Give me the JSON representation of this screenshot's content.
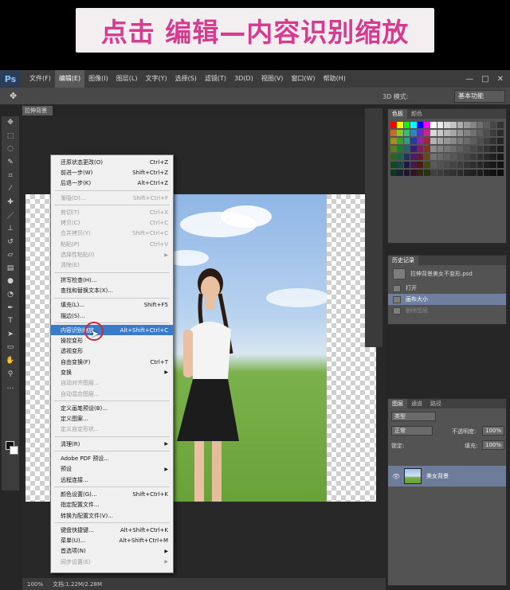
{
  "banner": {
    "title": "点击 编辑—内容识别缩放"
  },
  "menubar": {
    "logo": "Ps",
    "items": [
      "文件(F)",
      "编辑(E)",
      "图像(I)",
      "图层(L)",
      "文字(Y)",
      "选择(S)",
      "滤镜(T)",
      "3D(D)",
      "视图(V)",
      "窗口(W)",
      "帮助(H)"
    ],
    "window_controls": [
      "—",
      "□",
      "✕"
    ]
  },
  "optbar": {
    "mode_3d": "3D 模式:",
    "workspace": "基本功能"
  },
  "document": {
    "tab": "拉伸背景"
  },
  "edit_menu": {
    "items": [
      {
        "label": "还原状态更改(O)",
        "shortcut": "Ctrl+Z",
        "state": "normal"
      },
      {
        "label": "前进一步(W)",
        "shortcut": "Shift+Ctrl+Z",
        "state": "normal"
      },
      {
        "label": "后退一步(K)",
        "shortcut": "Alt+Ctrl+Z",
        "state": "normal"
      },
      {
        "sep": true
      },
      {
        "label": "渐隐(D)...",
        "shortcut": "Shift+Ctrl+F",
        "state": "disabled"
      },
      {
        "sep": true
      },
      {
        "label": "剪切(T)",
        "shortcut": "Ctrl+X",
        "state": "disabled"
      },
      {
        "label": "拷贝(C)",
        "shortcut": "Ctrl+C",
        "state": "disabled"
      },
      {
        "label": "合并拷贝(Y)",
        "shortcut": "Shift+Ctrl+C",
        "state": "disabled"
      },
      {
        "label": "粘贴(P)",
        "shortcut": "Ctrl+V",
        "state": "disabled"
      },
      {
        "label": "选择性粘贴(I)",
        "shortcut": "",
        "state": "disabled",
        "submenu": true
      },
      {
        "label": "清除(E)",
        "shortcut": "",
        "state": "disabled"
      },
      {
        "sep": true
      },
      {
        "label": "拼写检查(H)...",
        "shortcut": "",
        "state": "normal"
      },
      {
        "label": "查找和替换文本(X)...",
        "shortcut": "",
        "state": "normal"
      },
      {
        "sep": true
      },
      {
        "label": "填充(L)...",
        "shortcut": "Shift+F5",
        "state": "normal"
      },
      {
        "label": "描边(S)...",
        "shortcut": "",
        "state": "normal"
      },
      {
        "sep": true
      },
      {
        "label": "内容识别缩放",
        "shortcut": "Alt+Shift+Ctrl+C",
        "state": "highlight"
      },
      {
        "label": "操控变形",
        "shortcut": "",
        "state": "normal"
      },
      {
        "label": "透视变形",
        "shortcut": "",
        "state": "normal"
      },
      {
        "label": "自由变换(F)",
        "shortcut": "Ctrl+T",
        "state": "normal"
      },
      {
        "label": "变换",
        "shortcut": "",
        "state": "normal",
        "submenu": true
      },
      {
        "label": "自动对齐图层...",
        "shortcut": "",
        "state": "disabled"
      },
      {
        "label": "自动混合图层...",
        "shortcut": "",
        "state": "disabled"
      },
      {
        "sep": true
      },
      {
        "label": "定义画笔预设(B)...",
        "shortcut": "",
        "state": "normal"
      },
      {
        "label": "定义图案...",
        "shortcut": "",
        "state": "normal"
      },
      {
        "label": "定义自定形状...",
        "shortcut": "",
        "state": "disabled"
      },
      {
        "sep": true
      },
      {
        "label": "清理(R)",
        "shortcut": "",
        "state": "normal",
        "submenu": true
      },
      {
        "sep": true
      },
      {
        "label": "Adobe PDF 预设...",
        "shortcut": "",
        "state": "normal"
      },
      {
        "label": "预设",
        "shortcut": "",
        "state": "normal",
        "submenu": true
      },
      {
        "label": "远程连接...",
        "shortcut": "",
        "state": "normal"
      },
      {
        "sep": true
      },
      {
        "label": "颜色设置(G)...",
        "shortcut": "Shift+Ctrl+K",
        "state": "normal"
      },
      {
        "label": "指定配置文件...",
        "shortcut": "",
        "state": "normal"
      },
      {
        "label": "转换为配置文件(V)...",
        "shortcut": "",
        "state": "normal"
      },
      {
        "sep": true
      },
      {
        "label": "键盘快捷键...",
        "shortcut": "Alt+Shift+Ctrl+K",
        "state": "normal"
      },
      {
        "label": "菜单(U)...",
        "shortcut": "Alt+Shift+Ctrl+M",
        "state": "normal"
      },
      {
        "label": "首选项(N)",
        "shortcut": "",
        "state": "normal",
        "submenu": true
      },
      {
        "label": "同步设置(E)",
        "shortcut": "",
        "state": "disabled",
        "submenu": true
      }
    ]
  },
  "swatches_panel": {
    "tabs": [
      "色板",
      "颜色"
    ],
    "colors": [
      "#ff0000",
      "#ffff00",
      "#00ff00",
      "#00ffff",
      "#0000ff",
      "#ff00ff",
      "#ffffff",
      "#ebebeb",
      "#d6d6d6",
      "#c2c2c2",
      "#adadad",
      "#999999",
      "#858585",
      "#707070",
      "#5c5c5c",
      "#474747",
      "#333333"
    ]
  },
  "history_panel": {
    "tabs": [
      "历史记录"
    ],
    "file": "拉伸背景美女不变形.psd",
    "steps": [
      {
        "label": "打开",
        "state": "normal"
      },
      {
        "label": "画布大小",
        "state": "selected"
      },
      {
        "label": "删除图层",
        "state": "dim"
      }
    ]
  },
  "layers_panel": {
    "tabs": [
      "图层",
      "通道",
      "路径"
    ],
    "kind": "类型",
    "blend_mode": "正常",
    "opacity_label": "不透明度:",
    "opacity": "100%",
    "lock_label": "锁定:",
    "fill_label": "填充:",
    "fill": "100%",
    "layer_name": "美女背景"
  },
  "statusbar": {
    "zoom": "100%",
    "doc": "文档:1.22M/2.28M"
  }
}
